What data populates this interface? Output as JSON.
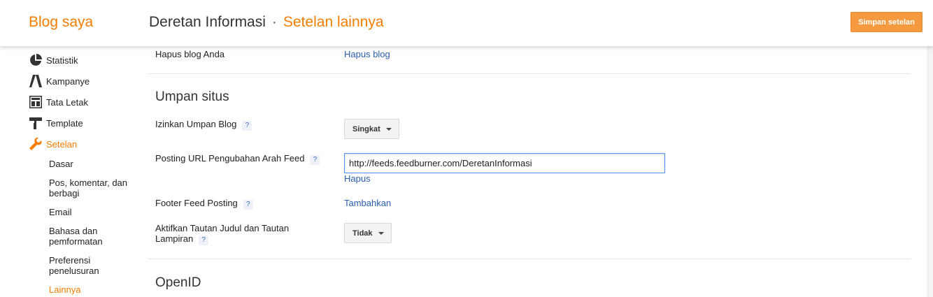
{
  "header": {
    "blog_name": "Blog saya",
    "title": "Deretan Informasi",
    "separator": "·",
    "subtitle": "Setelan lainnya",
    "save_label": "Simpan setelan"
  },
  "sidebar": {
    "items": [
      {
        "label": "Statistik",
        "icon": "pie-chart-icon"
      },
      {
        "label": "Kampanye",
        "icon": "campaign-icon"
      },
      {
        "label": "Tata Letak",
        "icon": "layout-icon"
      },
      {
        "label": "Template",
        "icon": "paint-roller-icon"
      },
      {
        "label": "Setelan",
        "icon": "wrench-icon"
      }
    ],
    "sub_items": [
      {
        "label": "Dasar"
      },
      {
        "label": "Pos, komentar, dan berbagi"
      },
      {
        "label": "Email"
      },
      {
        "label": "Bahasa dan pemformatan"
      },
      {
        "label": "Preferensi penelusuran"
      },
      {
        "label": "Lainnya"
      }
    ]
  },
  "main": {
    "delete_blog_label": "Hapus blog Anda",
    "delete_blog_link": "Hapus blog",
    "feed_section_title": "Umpan situs",
    "allow_feed_label": "Izinkan Umpan Blog",
    "allow_feed_value": "Singkat",
    "redirect_url_label": "Posting URL Pengubahan Arah Feed",
    "redirect_url_value": "http://feeds.feedburner.com/DeretanInformasi",
    "redirect_remove_link": "Hapus",
    "footer_feed_label": "Footer Feed Posting",
    "footer_feed_link": "Tambahkan",
    "title_links_label": "Aktifkan Tautan Judul dan Tautan Lampiran",
    "title_links_value": "Tidak",
    "openid_section_title": "OpenID",
    "help_glyph": "?"
  },
  "colors": {
    "accent": "#f57d00",
    "link": "#2a5db0",
    "save_button": "#f59a3f"
  }
}
